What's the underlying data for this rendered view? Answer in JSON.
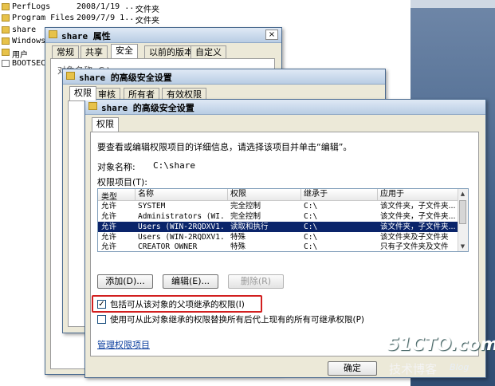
{
  "explorer": {
    "rows": [
      {
        "name": "PerfLogs",
        "date": "2008/1/19 ...",
        "type": "文件夹",
        "icon": "folder-icon"
      },
      {
        "name": "Program Files",
        "date": "2009/7/9 1...",
        "type": "文件夹",
        "icon": "folder-icon"
      },
      {
        "name": "share",
        "date": "",
        "type": "",
        "icon": "folder-icon"
      },
      {
        "name": "Windows",
        "date": "",
        "type": "",
        "icon": "folder-icon"
      },
      {
        "name": "用户",
        "date": "",
        "type": "",
        "icon": "folder-icon"
      },
      {
        "name": "BOOTSECT.",
        "date": "",
        "type": "",
        "icon": "file-icon"
      }
    ]
  },
  "props_window": {
    "title": "share 属性",
    "tabs": [
      "常规",
      "共享",
      "安全",
      "以前的版本",
      "自定义"
    ],
    "active_tab": "安全",
    "fragment": "对象名称:   C:\\",
    "close": "×"
  },
  "adv_window_back": {
    "title": "share 的高级安全设置",
    "tabs": [
      "权限",
      "审核",
      "所有者",
      "有效权限"
    ]
  },
  "adv_window": {
    "title": "share 的高级安全设置",
    "tab": "权限",
    "instruction": "要查看或编辑权限项目的详细信息，请选择该项目并单击“编辑”。",
    "object_label": "对象名称:",
    "object_value": "C:\\share",
    "entries_label": "权限项目(T):",
    "columns": [
      "类型",
      "名称",
      "权限",
      "继承于",
      "应用于"
    ],
    "rows": [
      {
        "type": "允许",
        "name": "SYSTEM",
        "perm": "完全控制",
        "inherit": "C:\\",
        "apply": "该文件夹，子文件夹..."
      },
      {
        "type": "允许",
        "name": "Administrators (WI...",
        "perm": "完全控制",
        "inherit": "C:\\",
        "apply": "该文件夹，子文件夹..."
      },
      {
        "type": "允许",
        "name": "Users (WIN-2RQDXV1...",
        "perm": "读取和执行",
        "inherit": "C:\\",
        "apply": "该文件夹，子文件夹..."
      },
      {
        "type": "允许",
        "name": "Users (WIN-2RQDXV1...",
        "perm": "特殊",
        "inherit": "C:\\",
        "apply": "该文件夹及子文件夹"
      },
      {
        "type": "允许",
        "name": "CREATOR OWNER",
        "perm": "特殊",
        "inherit": "C:\\",
        "apply": "只有子文件夹及文件"
      }
    ],
    "selected_row": 2,
    "buttons": {
      "add": "添加(D)...",
      "edit": "编辑(E)...",
      "delete": "删除(R)"
    },
    "check_inherit": "包括可从该对象的父项继承的权限(I)",
    "check_replace": "使用可从此对象继承的权限替换所有后代上现有的所有可继承权限(P)",
    "manage_link": "管理权限项目",
    "ok": "确定"
  },
  "watermark": {
    "site": "51CTO.com",
    "cn": "技术博客",
    "blog": "Blog"
  },
  "colors": {
    "selection": "#0a246a",
    "highlight_box": "#d21f1f",
    "link": "#0b3e9e"
  }
}
